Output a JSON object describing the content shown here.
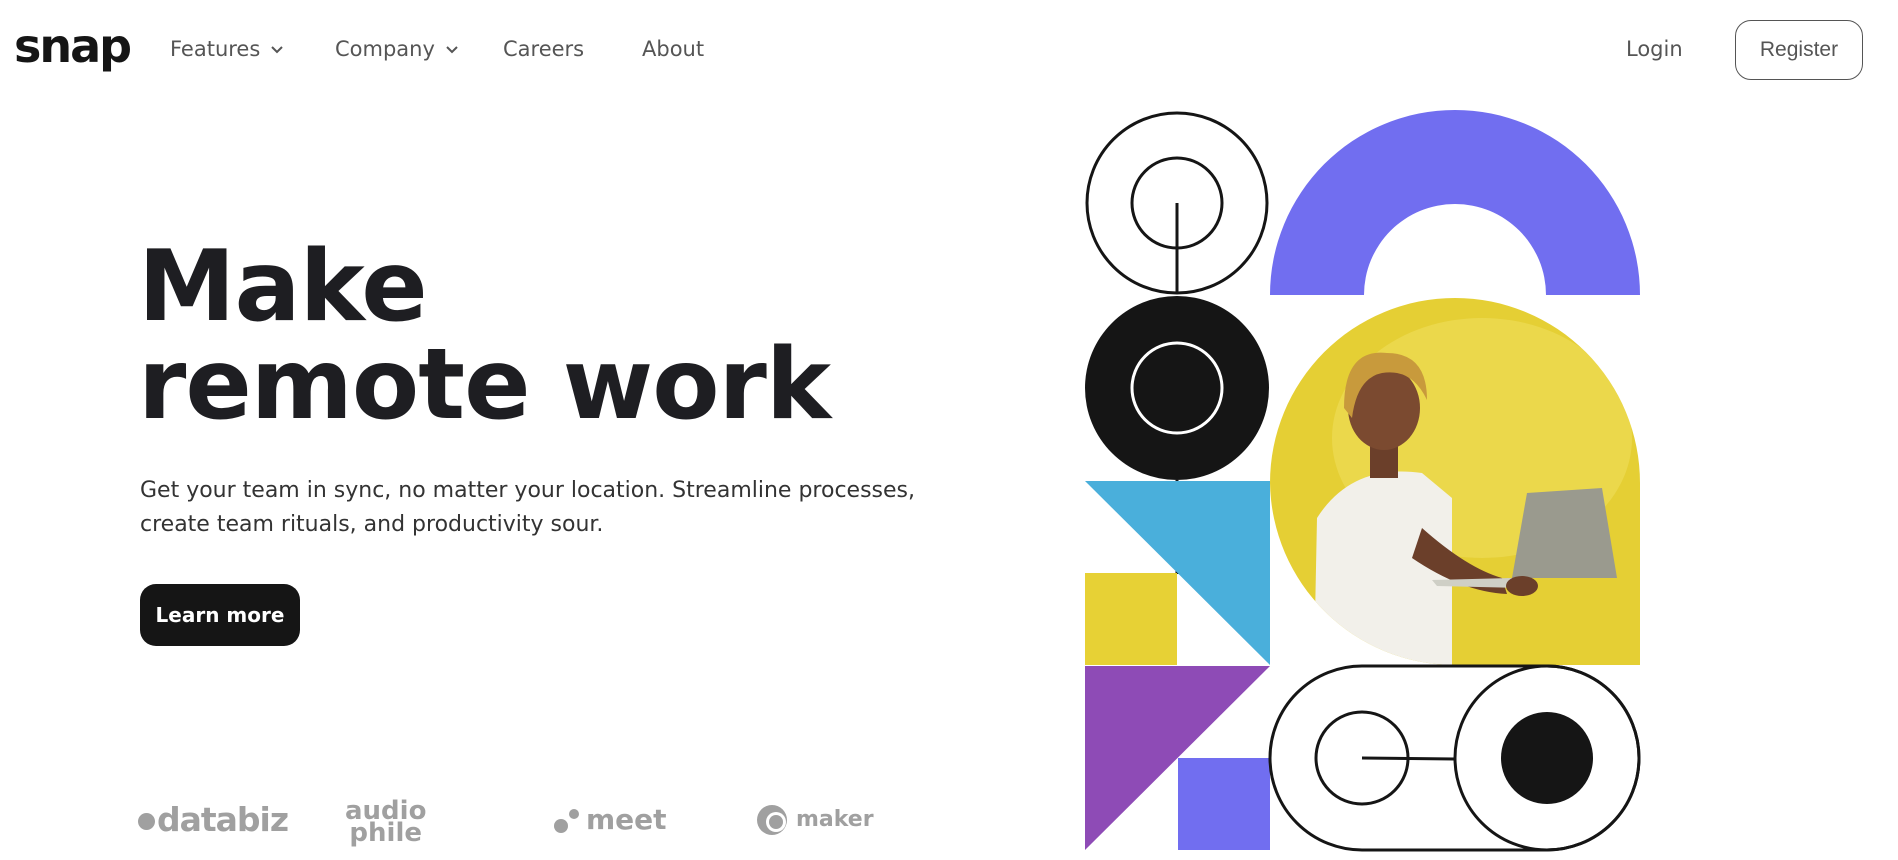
{
  "nav": {
    "logo": "snap",
    "items": [
      {
        "label": "Features",
        "has_dropdown": true,
        "icon": "chevron-down-icon"
      },
      {
        "label": "Company",
        "has_dropdown": true,
        "icon": "chevron-down-icon"
      },
      {
        "label": "Careers",
        "has_dropdown": false
      },
      {
        "label": "About",
        "has_dropdown": false
      }
    ],
    "login": "Login",
    "register": "Register"
  },
  "hero": {
    "title_line1": "Make",
    "title_line2": "remote work",
    "description_line1": "Get your team in sync, no matter your location. Streamline processes,",
    "description_line2": "create team rituals, and productivity sour.",
    "cta": "Learn more"
  },
  "clients": [
    {
      "name": "databiz"
    },
    {
      "name": "audio phile",
      "line1": "audio",
      "line2": "phile"
    },
    {
      "name": "meet"
    },
    {
      "name": "maker"
    }
  ],
  "illustration": {
    "photo_subject": "person holding laptop",
    "colors": {
      "purple": "#716ef0",
      "yellow": "#e7d135",
      "blue": "#4aafdb",
      "violet": "#8e4bb6",
      "black": "#151515"
    }
  }
}
